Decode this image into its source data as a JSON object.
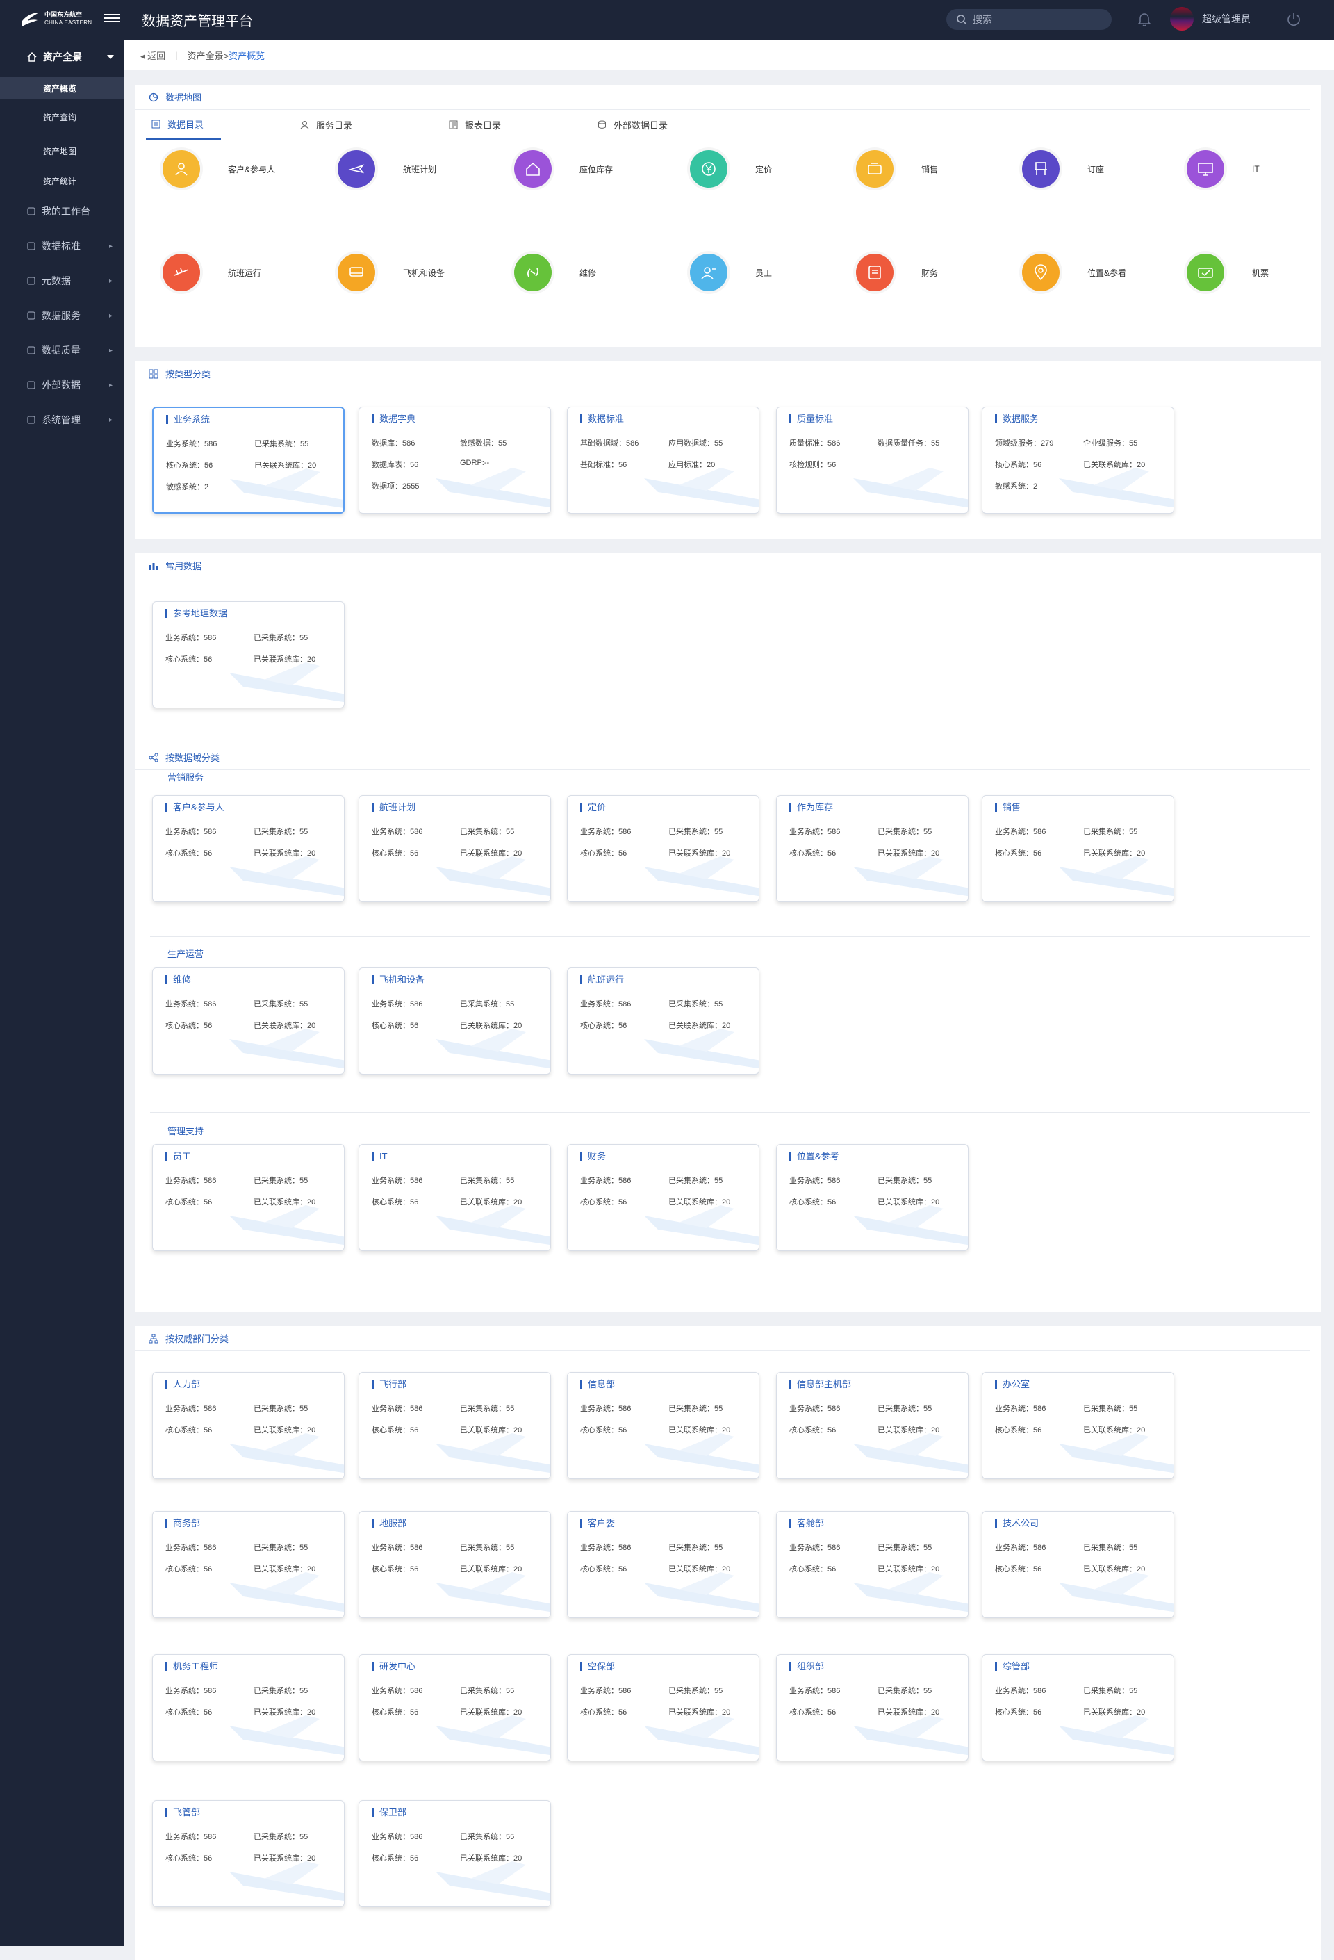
{
  "header": {
    "logo_cn": "中国东方航空",
    "logo_en": "CHINA EASTERN",
    "title": "数据资产管理平台",
    "search_placeholder": "搜索",
    "username": "超级管理员"
  },
  "sidebar": {
    "top": "资产全景",
    "subs": [
      "资产概览",
      "资产查询",
      "资产地图",
      "资产统计"
    ],
    "menus": [
      "我的工作台",
      "数据标准",
      "元数据",
      "数据服务",
      "数据质量",
      "外部数据",
      "系统管理"
    ]
  },
  "breadcrumb": {
    "back": "返回",
    "path": "资产全景>",
    "current": "资产概览"
  },
  "map": {
    "title": "数据地图",
    "tabs": [
      "数据目录",
      "服务目录",
      "报表目录",
      "外部数据目录"
    ],
    "categories": [
      {
        "label": "客户&参与人",
        "color": "#f5b731",
        "icon": "person-icon"
      },
      {
        "label": "航班计划",
        "color": "#5a49c8",
        "icon": "plane-icon"
      },
      {
        "label": "座位库存",
        "color": "#9b53d9",
        "icon": "house-icon"
      },
      {
        "label": "定价",
        "color": "#34c3a0",
        "icon": "yuan-icon"
      },
      {
        "label": "销售",
        "color": "#f5b731",
        "icon": "sale-icon"
      },
      {
        "label": "订座",
        "color": "#5a49c8",
        "icon": "seat-icon"
      },
      {
        "label": "IT",
        "color": "#9b53d9",
        "icon": "monitor-icon"
      },
      {
        "label": "航班运行",
        "color": "#ee5a3c",
        "icon": "flight-icon"
      },
      {
        "label": "飞机和设备",
        "color": "#f5a623",
        "icon": "equipment-icon"
      },
      {
        "label": "维修",
        "color": "#66c23a",
        "icon": "repair-icon"
      },
      {
        "label": "员工",
        "color": "#4fb5ea",
        "icon": "staff-icon"
      },
      {
        "label": "财务",
        "color": "#ee5a3c",
        "icon": "finance-icon"
      },
      {
        "label": "位置&参看",
        "color": "#f5a623",
        "icon": "location-icon"
      },
      {
        "label": "机票",
        "color": "#66c23a",
        "icon": "ticket-icon"
      }
    ]
  },
  "by_type": {
    "title": "按类型分类",
    "cards": [
      {
        "title": "业务系统",
        "stats": [
          "业务系统：586",
          "已采集系统：55",
          "核心系统：56",
          "已关联系统库：20",
          "敏感系统：2"
        ]
      },
      {
        "title": "数据字典",
        "stats": [
          "数据库：586",
          "敏感数据：55",
          "数据库表：56",
          "GDRP:--",
          "数据项：2555"
        ]
      },
      {
        "title": "数据标准",
        "stats": [
          "基础数据域：586",
          "应用数据域：55",
          "基础标准：56",
          "应用标准：20"
        ]
      },
      {
        "title": "质量标准",
        "stats": [
          "质量标准：586",
          "数据质量任务：55",
          "核检规则：56"
        ]
      },
      {
        "title": "数据服务",
        "stats": [
          "领域级服务：279",
          "企业级服务：55",
          "核心系统：56",
          "已关联系统库：20",
          "敏感系统：2"
        ]
      }
    ]
  },
  "common": {
    "title": "常用数据",
    "cards": [
      {
        "title": "参考地理数据",
        "stats": [
          "业务系统：586",
          "已采集系统：55",
          "核心系统：56",
          "已关联系统库：20"
        ]
      }
    ]
  },
  "by_domain": {
    "title": "按数据域分类",
    "groups": [
      {
        "name": "营销服务",
        "cards": [
          "客户&参与人",
          "航班计划",
          "定价",
          "作为库存",
          "销售"
        ]
      },
      {
        "name": "生产运营",
        "cards": [
          "维修",
          "飞机和设备",
          "航班运行"
        ]
      },
      {
        "name": "管理支持",
        "cards": [
          "员工",
          "IT",
          "财务",
          "位置&参考"
        ]
      }
    ]
  },
  "by_dept": {
    "title": "按权威部门分类",
    "cards": [
      "人力部",
      "飞行部",
      "信息部",
      "信息部主机部",
      "办公室",
      "商务部",
      "地服部",
      "客户委",
      "客舱部",
      "技术公司",
      "机务工程师",
      "研发中心",
      "空保部",
      "组织部",
      "综管部",
      "飞管部",
      "保卫部"
    ]
  },
  "std_stats": [
    "业务系统：586",
    "已采集系统：55",
    "核心系统：56",
    "已关联系统库：20"
  ]
}
